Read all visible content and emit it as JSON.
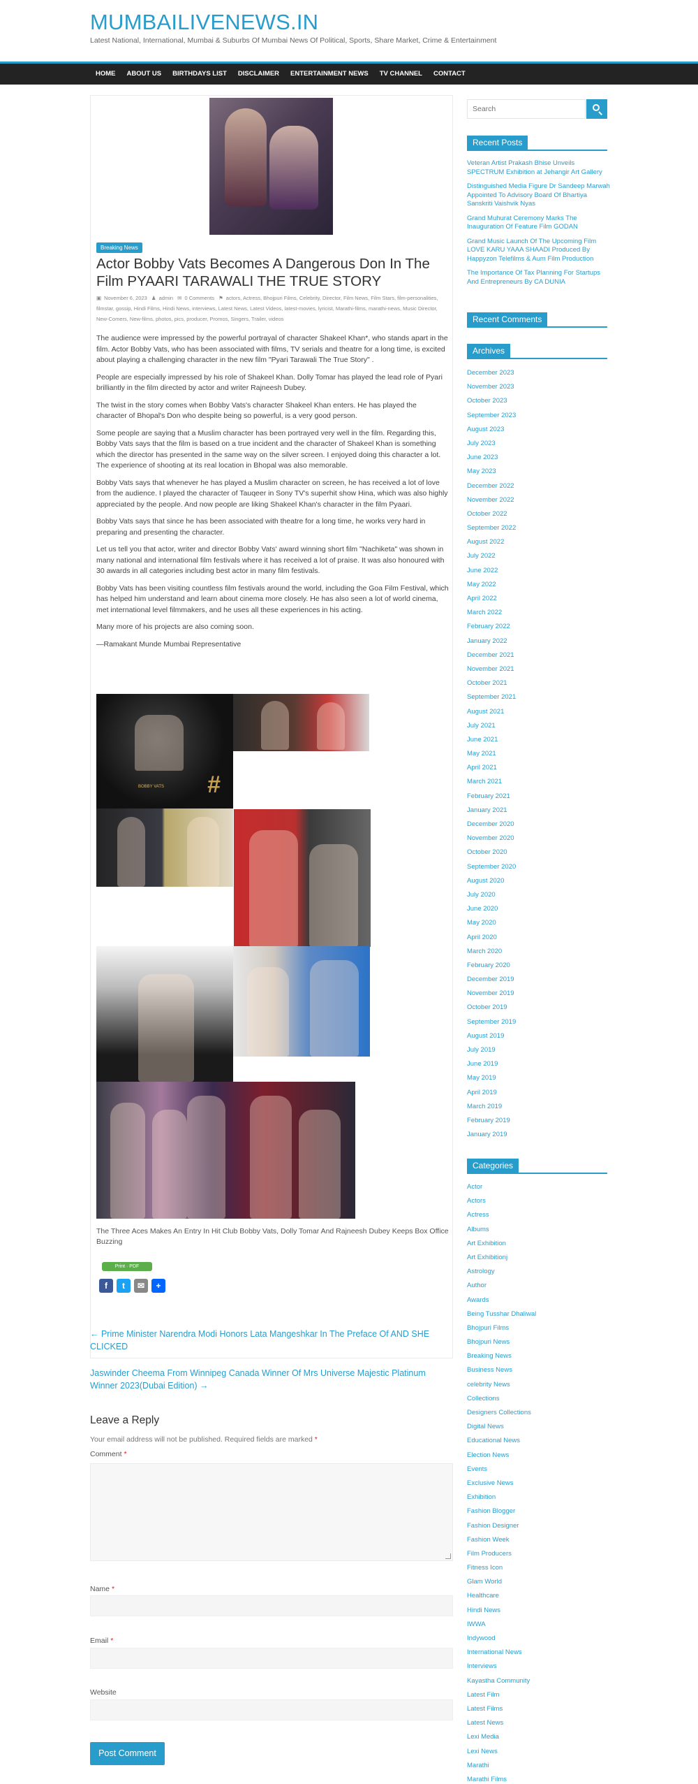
{
  "site": {
    "title": "MUMBAILIVENEWS.IN",
    "description": "Latest National, International, Mumbai & Suburbs Of Mumbai News Of Political, Sports, Share Market, Crime & Entertainment"
  },
  "nav": [
    "HOME",
    "ABOUT US",
    "BIRTHDAYS LIST",
    "DISCLAIMER",
    "ENTERTAINMENT NEWS",
    "TV CHANNEL",
    "CONTACT"
  ],
  "post": {
    "category": "Breaking News",
    "title": "Actor Bobby Vats Becomes A Dangerous Don In The Film PYAARI TARAWALI THE TRUE STORY",
    "date": "November 6, 2023",
    "author": "admin",
    "comments": "0 Comments",
    "tags": "actors, Actress, Bhojpuri Films, Celebrity, Director, Film News, Film Stars, film-personalities, filmstar, gossip, Hindi Films, Hindi News, interviews, Latest News, Latest Videos, latest-movies, lyricist, Marathi-films, marathi-news, Music Director, New-Comers, New-films, photos, pics, producer, Promos, Singers, Trailer, videos",
    "paragraphs": [
      "The audience were impressed by the powerful portrayal of character Shakeel Khan*, who stands apart in the film. Actor Bobby Vats, who has been associated with films, TV serials and theatre for a long time, is excited about playing a challenging character in the new film \"Pyari Tarawali The True Story\" .",
      "People are especially impressed by his role of Shakeel Khan. Dolly Tomar has played the lead role of Pyari brilliantly in the film directed by actor and writer Rajneesh Dubey.",
      "The twist in the story comes when Bobby Vats's character Shakeel Khan enters. He has played the character of Bhopal's Don who despite being so powerful, is a very good person.",
      "Some people are saying that a Muslim character has been portrayed very well in the film. Regarding this, Bobby Vats says that the film is based on a true incident and the character of Shakeel Khan is something which the director has presented in the same way on the silver screen. I enjoyed doing this character a lot. The experience of shooting at its real location in Bhopal was also memorable.",
      "Bobby Vats says that whenever he has played a Muslim character on screen, he has received a lot of love from the audience. I played the character of Tauqeer in Sony TV's superhit show Hina, which was also highly appreciated by the people. And now people are liking Shakeel Khan's character in the  film Pyaari.",
      "Bobby Vats says that since he has been associated with theatre for a long time, he works very hard in preparing and presenting the character.",
      "Let us tell you that actor, writer and director Bobby Vats' award winning short film \"Nachiketa\" was shown in many national and international film festivals where it has received a lot of praise. It was also honoured with 30 awards in all categories including best actor in many film festivals.",
      "Bobby Vats has been visiting countless film festivals around the world, including the Goa Film Festival, which has helped him understand and learn about cinema more closely. He has also seen a lot of world cinema, met international level filmmakers, and he uses all these experiences in his acting.",
      "Many more of his projects are also coming soon.",
      "—Ramakant Munde Mumbai Representative"
    ],
    "gallery_label": "BOBBY VATS",
    "caption": "The Three Aces Makes An Entry In Hit Club Bobby Vats, Dolly Tomar And Rajneesh Dubey Keeps Box Office Buzzing",
    "print_label": "Print · PDF"
  },
  "post_nav": {
    "prev": "← Prime Minister Narendra Modi Honors Lata Mangeshkar In The Preface Of AND SHE CLICKED",
    "next": "Jaswinder Cheema From Winnipeg Canada Winner Of Mrs Universe Majestic Platinum Winner 2023(Dubai Edition) →"
  },
  "reply": {
    "title": "Leave a Reply",
    "note": "Your email address will not be published. Required fields are marked",
    "required_mark": "*",
    "comment_label": "Comment",
    "name_label": "Name",
    "email_label": "Email",
    "website_label": "Website",
    "submit": "Post Comment"
  },
  "sidebar": {
    "search_placeholder": "Search",
    "recent_posts_title": "Recent Posts",
    "recent_posts": [
      "Veteran Artist Prakash Bhise Unveils SPECTRUM Exhibition at Jehangir Art Gallery",
      "Distinguished Media Figure Dr Sandeep Marwah Appointed To Advisory Board Of Bhartiya Sanskriti Vaishvik Nyas",
      "Grand Muhurat Ceremony Marks The Inauguration Of Feature Film GODAN",
      "Grand Music Launch Of The Upcoming Film LOVE KARU YAAA SHAADI Produced By Happyzon Telefilms & Aum Film Production",
      "The Importance Of Tax Planning For Startups And Entrepreneurs By CA DUNIA"
    ],
    "recent_comments_title": "Recent Comments",
    "archives_title": "Archives",
    "archives": [
      "December 2023",
      "November 2023",
      "October 2023",
      "September 2023",
      "August 2023",
      "July 2023",
      "June 2023",
      "May 2023",
      "December 2022",
      "November 2022",
      "October 2022",
      "September 2022",
      "August 2022",
      "July 2022",
      "June 2022",
      "May 2022",
      "April 2022",
      "March 2022",
      "February 2022",
      "January 2022",
      "December 2021",
      "November 2021",
      "October 2021",
      "September 2021",
      "August 2021",
      "July 2021",
      "June 2021",
      "May 2021",
      "April 2021",
      "March 2021",
      "February 2021",
      "January 2021",
      "December 2020",
      "November 2020",
      "October 2020",
      "September 2020",
      "August 2020",
      "July 2020",
      "June 2020",
      "May 2020",
      "April 2020",
      "March 2020",
      "February 2020",
      "December 2019",
      "November 2019",
      "October 2019",
      "September 2019",
      "August 2019",
      "July 2019",
      "June 2019",
      "May 2019",
      "April 2019",
      "March 2019",
      "February 2019",
      "January 2019"
    ],
    "categories_title": "Categories",
    "categories": [
      "Actor",
      "Actors",
      "Actress",
      "Albums",
      "Art Exhibition",
      "Art Exhibitionj",
      "Astrology",
      "Author",
      "Awards",
      "Being Tusshar Dhaliwal",
      "Bhojpuri Films",
      "Bhojpuri News",
      "Breaking News",
      "Business News",
      "celebrity News",
      "Collections",
      "Designers Collections",
      "Digital News",
      "Educational News",
      "Election News",
      "Events",
      "Exclusive News",
      "Exhibition",
      "Fashion Blogger",
      "Fashion Designer",
      "Fashion Week",
      "Film Producers",
      "Fitness Icon",
      "Glam World",
      "Healthcare",
      "Hindi News",
      "IWWA",
      "Indywood",
      "International News",
      "Interviews",
      "Kayastha Community",
      "Latest Film",
      "Latest Films",
      "Latest News",
      "Lexi Media",
      "Lexi News",
      "Marathi",
      "Marathi Films"
    ]
  },
  "colors": {
    "accent": "#289dcc",
    "nav_bg": "#232323"
  }
}
